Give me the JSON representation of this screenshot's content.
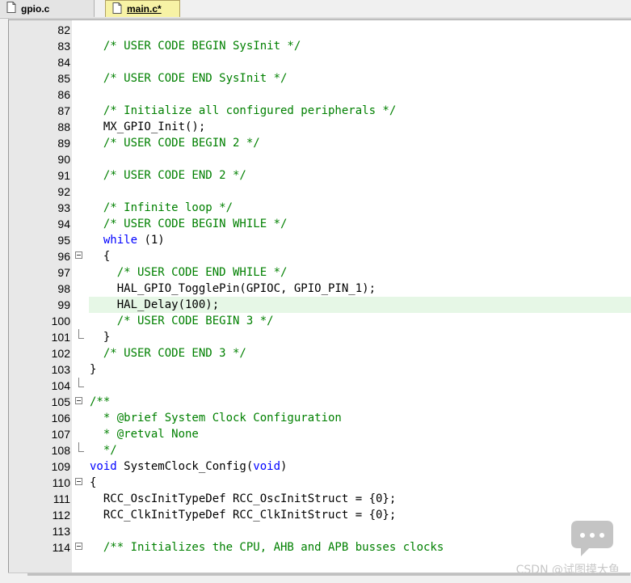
{
  "tabs": [
    {
      "label": "gpio.c",
      "active": false
    },
    {
      "label": "main.c*",
      "active": true
    }
  ],
  "lines": [
    {
      "n": "82",
      "text": "",
      "fold": ""
    },
    {
      "n": "83",
      "text": "  /* USER CODE BEGIN SysInit */",
      "fold": "",
      "cls": "com"
    },
    {
      "n": "84",
      "text": "",
      "fold": ""
    },
    {
      "n": "85",
      "text": "  /* USER CODE END SysInit */",
      "fold": "",
      "cls": "com"
    },
    {
      "n": "86",
      "text": "",
      "fold": ""
    },
    {
      "n": "87",
      "text": "  /* Initialize all configured peripherals */",
      "fold": "",
      "cls": "com"
    },
    {
      "n": "88",
      "text": "  MX_GPIO_Init();",
      "fold": ""
    },
    {
      "n": "89",
      "text": "  /* USER CODE BEGIN 2 */",
      "fold": "",
      "cls": "com"
    },
    {
      "n": "90",
      "text": "",
      "fold": ""
    },
    {
      "n": "91",
      "text": "  /* USER CODE END 2 */",
      "fold": "",
      "cls": "com"
    },
    {
      "n": "92",
      "text": "",
      "fold": ""
    },
    {
      "n": "93",
      "text": "  /* Infinite loop */",
      "fold": "",
      "cls": "com"
    },
    {
      "n": "94",
      "text": "  /* USER CODE BEGIN WHILE */",
      "fold": "",
      "cls": "com"
    },
    {
      "n": "95",
      "text": "  while (1)",
      "fold": "",
      "cls": "while"
    },
    {
      "n": "96",
      "text": "  {",
      "fold": "open"
    },
    {
      "n": "97",
      "text": "    /* USER CODE END WHILE */",
      "fold": "",
      "cls": "com"
    },
    {
      "n": "98",
      "text": "    HAL_GPIO_TogglePin(GPIOC, GPIO_PIN_1);",
      "fold": ""
    },
    {
      "n": "99",
      "text": "    HAL_Delay(100);",
      "fold": "",
      "hl": true
    },
    {
      "n": "100",
      "text": "    /* USER CODE BEGIN 3 */",
      "fold": "",
      "cls": "com"
    },
    {
      "n": "101",
      "text": "  }",
      "fold": "end"
    },
    {
      "n": "102",
      "text": "  /* USER CODE END 3 */",
      "fold": "",
      "cls": "com"
    },
    {
      "n": "103",
      "text": "}",
      "fold": ""
    },
    {
      "n": "104",
      "text": "",
      "fold": "end"
    },
    {
      "n": "105",
      "text": "/**",
      "fold": "open",
      "cls": "com"
    },
    {
      "n": "106",
      "text": "  * @brief System Clock Configuration",
      "fold": "",
      "cls": "com"
    },
    {
      "n": "107",
      "text": "  * @retval None",
      "fold": "",
      "cls": "com"
    },
    {
      "n": "108",
      "text": "  */",
      "fold": "end",
      "cls": "com"
    },
    {
      "n": "109",
      "text": "void SystemClock_Config(void)",
      "fold": "",
      "cls": "void"
    },
    {
      "n": "110",
      "text": "{",
      "fold": "open"
    },
    {
      "n": "111",
      "text": "  RCC_OscInitTypeDef RCC_OscInitStruct = {0};",
      "fold": ""
    },
    {
      "n": "112",
      "text": "  RCC_ClkInitTypeDef RCC_ClkInitStruct = {0};",
      "fold": ""
    },
    {
      "n": "113",
      "text": "",
      "fold": ""
    },
    {
      "n": "114",
      "text": "  /** Initializes the CPU, AHB and APB busses clocks",
      "fold": "open",
      "cls": "com"
    }
  ],
  "watermark": "CSDN @试图摸大鱼"
}
